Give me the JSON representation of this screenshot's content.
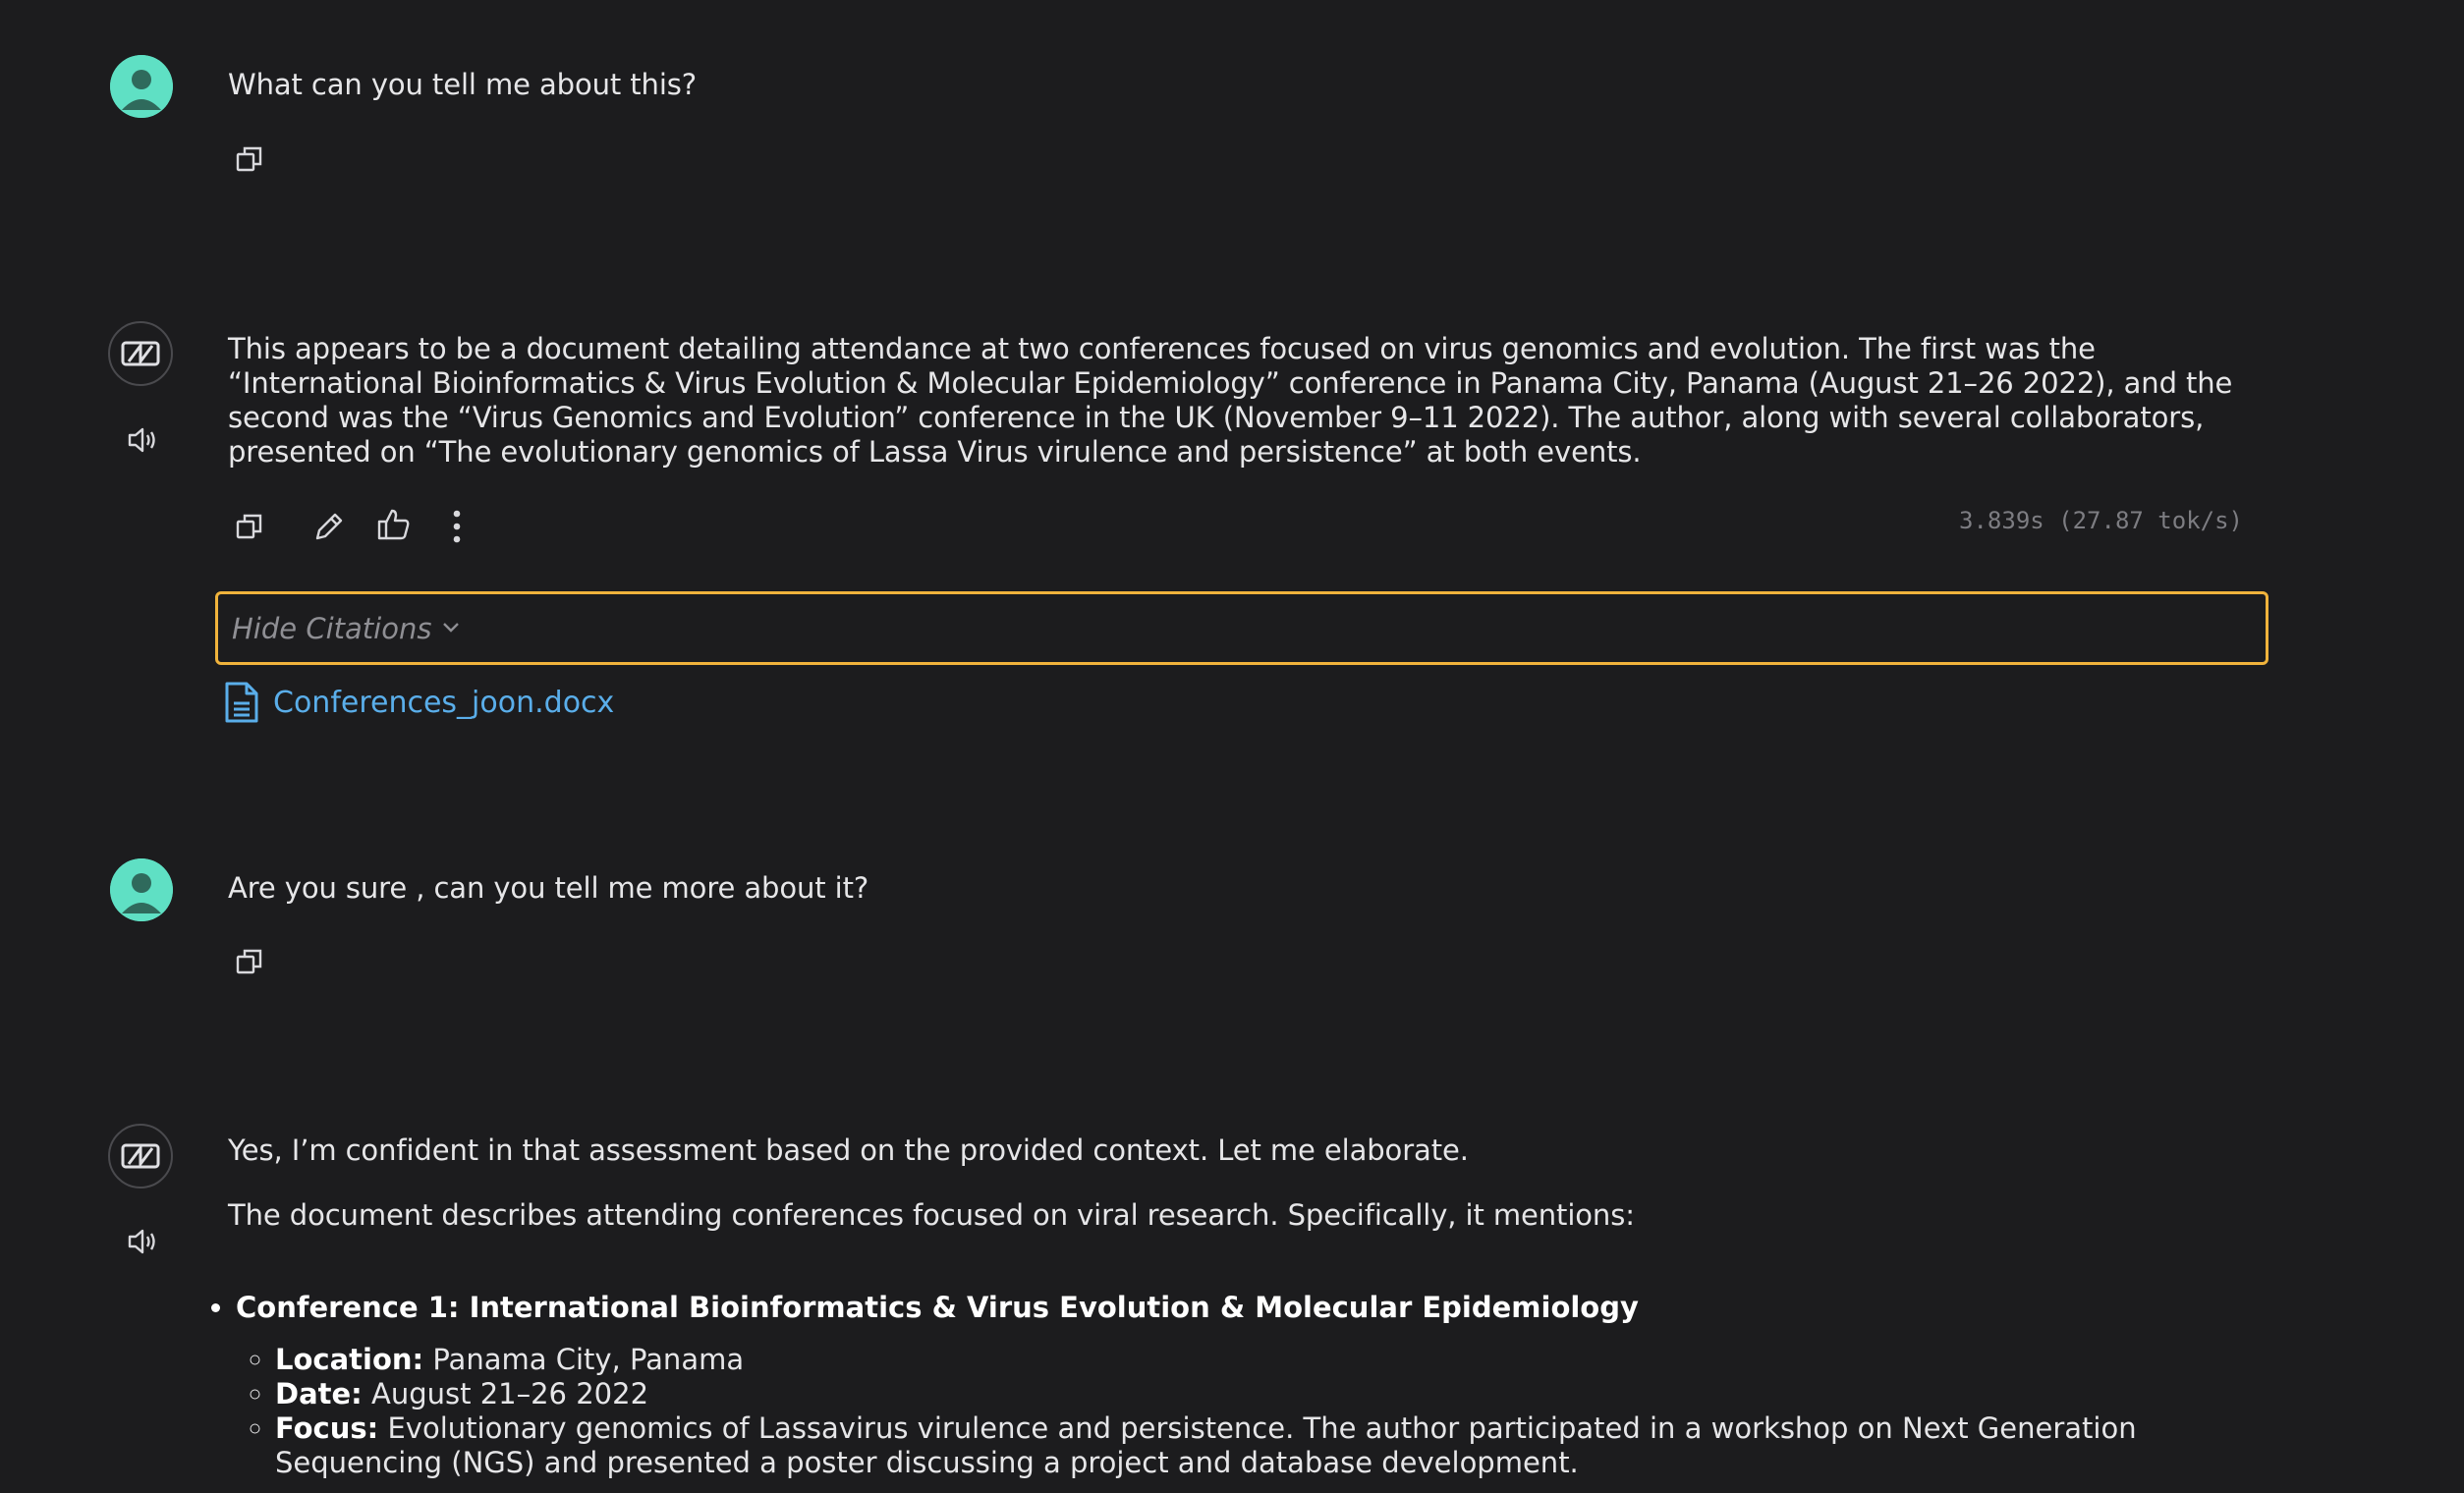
{
  "messages": {
    "user1": {
      "text": "What can you tell me about this?"
    },
    "bot1": {
      "text": "This appears to be a document detailing attendance at two conferences focused on virus genomics and evolution. The first was the “International Bioinformatics & Virus Evolution & Molecular Epidemiology” conference in Panama City, Panama (August 21–26 2022), and the second was the “Virus Genomics and Evolution” conference in the UK (November 9–11 2022). The author, along with several collaborators, presented on “The evolutionary genomics of Lassa Virus virulence and persistence” at both events.",
      "timing": "3.839s (27.87 tok/s)",
      "citations_toggle_label": "Hide Citations",
      "citation_file": "Conferences_joon.docx"
    },
    "user2": {
      "text": "Are you sure , can you tell me more about it?"
    },
    "bot2": {
      "para1": "Yes, I’m confident in that assessment based on the provided context. Let me elaborate.",
      "para2": "The document describes attending conferences focused on viral research. Specifically, it mentions:",
      "conference1_title": "Conference 1: International Bioinformatics & Virus Evolution & Molecular Epidemiology",
      "location_label": "Location:",
      "location_value": " Panama City, Panama",
      "date_label": "Date:",
      "date_value": " August 21–26 2022",
      "focus_label": "Focus:",
      "focus_value": " Evolutionary genomics of Lassavirus virulence and persistence. The author participated in a workshop on Next Generation Sequencing (NGS) and presented a poster discussing a project and database development."
    }
  },
  "colors": {
    "background": "#1c1c1e",
    "user_avatar": "#5fe0c4",
    "citation_border": "#f0b33c",
    "link": "#5aaeea"
  },
  "icons": {
    "copy": "copy-icon",
    "edit": "pencil-icon",
    "like": "thumbs-up-icon",
    "more": "more-vertical-icon",
    "speaker": "speaker-icon",
    "bot_logo": "model-logo-icon",
    "document": "document-icon",
    "chevron": "chevron-down-icon"
  }
}
